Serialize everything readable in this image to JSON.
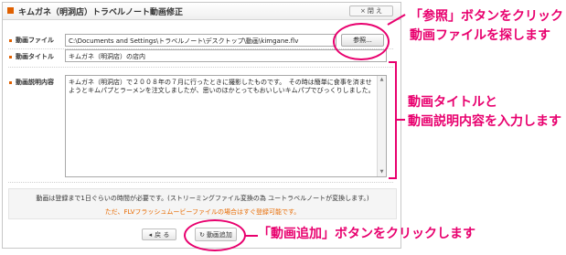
{
  "window": {
    "title": "キムガネ（明洞店）トラベルノート動画修正",
    "close_label": "閉 え"
  },
  "form": {
    "file_label": "動画ファイル",
    "file_value": "C:\\Documents and Settings\\トラベルノート\\デスクトップ\\動画\\kimgane.flv",
    "browse_label": "参照...",
    "title_label": "動画タイトル",
    "title_value": "キムガネ（明洞店）の店内",
    "desc_label": "動画説明内容",
    "desc_value": "キムガネ（明洞店）で２００８年の７月に行ったときに撮影したものです。　その時は簡単に食事を済ませようとキムパプとラーメンを注文しましたが、思いのほかとってもおいしいキムパプでびっくりしました。"
  },
  "notice": {
    "line1": "動画は登録まで1日ぐらいの時間が必要です。(ストリーミングファイル変換の為 ユートラベルノートが変換します。)",
    "line2": "ただ、FLVフラッシュムービーファイルの場合はすぐ登録可能です。"
  },
  "buttons": {
    "back_label": "戻 る",
    "add_label": "動画追加"
  },
  "annotations": {
    "browse_line1": "「参照」ボタンをクリックし",
    "browse_line2": "動画ファイルを探します",
    "input_line1": "動画タイトルと",
    "input_line2": "動画説明内容を入力します",
    "add_text": "「動画追加」ボタンをクリックします"
  },
  "colors": {
    "accent": "#e8006e",
    "title_bullet": "#e06000",
    "notice_orange": "#e86a00"
  }
}
